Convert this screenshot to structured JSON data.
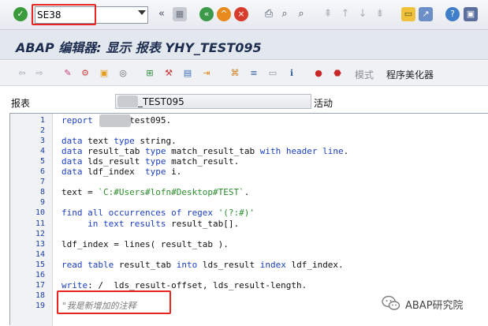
{
  "command_field": {
    "value": "SE38",
    "placeholder": ""
  },
  "title": "ABAP 编辑器: 显示 报表 YHY_TEST095",
  "app_toolbar": {
    "tmode_label": "模式",
    "pretty_printer_label": "程序美化器"
  },
  "program": {
    "label": "报表",
    "value": "_TEST095",
    "status": "活动"
  },
  "editor": {
    "line_numbers": [
      "1",
      "2",
      "3",
      "4",
      "5",
      "6",
      "7",
      "8",
      "9",
      "10",
      "11",
      "12",
      "13",
      "14",
      "15",
      "16",
      "17",
      "18",
      "19"
    ],
    "lines": [
      [
        {
          "t": "report ",
          "c": "kw"
        },
        {
          "t": "      test095.",
          "c": ""
        }
      ],
      [],
      [
        {
          "t": "data ",
          "c": "kw"
        },
        {
          "t": "text ",
          "c": ""
        },
        {
          "t": "type ",
          "c": "kw"
        },
        {
          "t": "string.",
          "c": ""
        }
      ],
      [
        {
          "t": "data ",
          "c": "kw"
        },
        {
          "t": "result_tab ",
          "c": ""
        },
        {
          "t": "type ",
          "c": "kw"
        },
        {
          "t": "match_result_tab ",
          "c": ""
        },
        {
          "t": "with header line",
          "c": "kw"
        },
        {
          "t": ".",
          "c": ""
        }
      ],
      [
        {
          "t": "data ",
          "c": "kw"
        },
        {
          "t": "lds_result ",
          "c": ""
        },
        {
          "t": "type ",
          "c": "kw"
        },
        {
          "t": "match_result.",
          "c": ""
        }
      ],
      [
        {
          "t": "data ",
          "c": "kw"
        },
        {
          "t": "ldf_index  ",
          "c": ""
        },
        {
          "t": "type ",
          "c": "kw"
        },
        {
          "t": "i.",
          "c": ""
        }
      ],
      [],
      [
        {
          "t": "text = ",
          "c": ""
        },
        {
          "t": "`C:#Users#lofn#Desktop#TEST`",
          "c": "str"
        },
        {
          "t": ".",
          "c": ""
        }
      ],
      [],
      [
        {
          "t": "find all occurrences of regex ",
          "c": "kw"
        },
        {
          "t": "'(?:#)'",
          "c": "str"
        }
      ],
      [
        {
          "t": "     in text ",
          "c": "kw"
        },
        {
          "t": "results ",
          "c": "kw"
        },
        {
          "t": "result_tab[].",
          "c": ""
        }
      ],
      [],
      [
        {
          "t": "ldf_index = lines( result_tab ).",
          "c": ""
        }
      ],
      [],
      [
        {
          "t": "read table ",
          "c": "kw"
        },
        {
          "t": "result_tab ",
          "c": ""
        },
        {
          "t": "into ",
          "c": "kw"
        },
        {
          "t": "lds_result ",
          "c": ""
        },
        {
          "t": "index ",
          "c": "kw"
        },
        {
          "t": "ldf_index.",
          "c": ""
        }
      ],
      [],
      [
        {
          "t": "write",
          "c": "kw"
        },
        {
          "t": ": /  lds_result-offset, lds_result-length.",
          "c": ""
        }
      ],
      [],
      [
        {
          "t": "\"我是新增加的注释",
          "c": "cm"
        }
      ]
    ]
  },
  "watermark": "ABAP研究院",
  "colors": {
    "highlight_box": "#e8251f",
    "keyword": "#1b3fbf",
    "string": "#2a8c2a",
    "comment": "#7a7a7a",
    "line_number": "#1c3fa0"
  },
  "icons": [
    "enter-icon",
    "back-icon",
    "save-icon",
    "green-back-icon",
    "exit-icon",
    "cancel-icon",
    "print-icon",
    "find-icon",
    "find-next-icon",
    "first-page-icon",
    "prev-page-icon",
    "next-page-icon",
    "last-page-icon",
    "new-session-icon",
    "shortcut-icon",
    "help-icon",
    "customize-layout-icon"
  ]
}
